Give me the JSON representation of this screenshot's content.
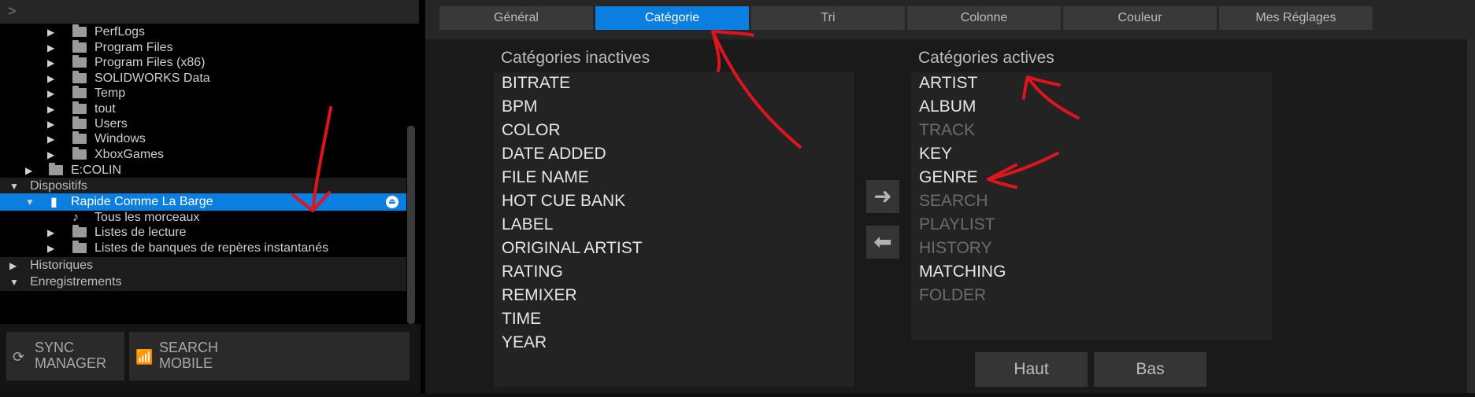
{
  "left_header": {
    "chevron": ">"
  },
  "tree": {
    "items": [
      {
        "label": "PerfLogs",
        "type": "folder"
      },
      {
        "label": "Program Files",
        "type": "folder"
      },
      {
        "label": "Program Files (x86)",
        "type": "folder"
      },
      {
        "label": "SOLIDWORKS Data",
        "type": "folder"
      },
      {
        "label": "Temp",
        "type": "folder"
      },
      {
        "label": "tout",
        "type": "folder"
      },
      {
        "label": "Users",
        "type": "folder"
      },
      {
        "label": "Windows",
        "type": "folder"
      },
      {
        "label": "XboxGames",
        "type": "folder"
      },
      {
        "label": "E:COLIN",
        "type": "drive"
      },
      {
        "label": "Dispositifs",
        "type": "section"
      },
      {
        "label": "Rapide Comme La Barge",
        "type": "device",
        "selected": true
      },
      {
        "label": "Tous les morceaux",
        "type": "music"
      },
      {
        "label": "Listes de lecture",
        "type": "folder"
      },
      {
        "label": "Listes de banques de repères instantanés",
        "type": "folder"
      },
      {
        "label": "Historiques",
        "type": "section"
      },
      {
        "label": "Enregistrements",
        "type": "section"
      }
    ]
  },
  "buttons_left": {
    "sync": {
      "line1": "SYNC",
      "line2": "MANAGER"
    },
    "search_mobile": {
      "line1": "SEARCH",
      "line2": "MOBILE"
    }
  },
  "tabs": [
    {
      "label": "Général",
      "active": false
    },
    {
      "label": "Catégorie",
      "active": true
    },
    {
      "label": "Tri",
      "active": false
    },
    {
      "label": "Colonne",
      "active": false
    },
    {
      "label": "Couleur",
      "active": false
    },
    {
      "label": "Mes Réglages",
      "active": false
    }
  ],
  "inactive": {
    "title": "Catégories inactives",
    "items": [
      "BITRATE",
      "BPM",
      "COLOR",
      "DATE ADDED",
      "FILE NAME",
      "HOT CUE BANK",
      "LABEL",
      "ORIGINAL ARTIST",
      "RATING",
      "REMIXER",
      "TIME",
      "YEAR"
    ]
  },
  "active": {
    "title": "Catégories actives",
    "items": [
      {
        "label": "ARTIST",
        "enabled": true
      },
      {
        "label": "ALBUM",
        "enabled": true
      },
      {
        "label": "TRACK",
        "enabled": false
      },
      {
        "label": "KEY",
        "enabled": true
      },
      {
        "label": "GENRE",
        "enabled": true
      },
      {
        "label": "SEARCH",
        "enabled": false
      },
      {
        "label": "PLAYLIST",
        "enabled": false
      },
      {
        "label": "HISTORY",
        "enabled": false
      },
      {
        "label": "MATCHING",
        "enabled": true
      },
      {
        "label": "FOLDER",
        "enabled": false
      }
    ]
  },
  "move_buttons": {
    "right": "➜",
    "left": "⬅"
  },
  "order_buttons": {
    "up": "Haut",
    "down": "Bas"
  },
  "colors": {
    "accent": "#0a7fe0",
    "annotation": "#e0141e"
  }
}
